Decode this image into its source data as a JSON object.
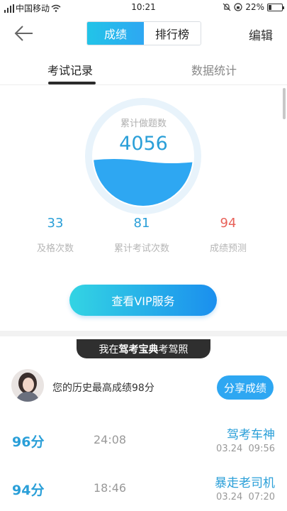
{
  "status_bar": {
    "carrier": "中国移动",
    "time": "10:21",
    "battery": "22%",
    "battery_level": 0.22
  },
  "header": {
    "tabs": [
      "成绩",
      "排行榜"
    ],
    "active_tab": 0,
    "edit_label": "编辑"
  },
  "sub_tabs": [
    "考试记录",
    "数据统计"
  ],
  "gauge": {
    "label": "累计做题数",
    "value": "4056",
    "fill_fraction": 0.45,
    "colors": {
      "ring": "#e8f3fb",
      "wave": "#2ea7f2"
    }
  },
  "stats": [
    {
      "value": "33",
      "label": "及格次数",
      "color": "#2a9fd8"
    },
    {
      "value": "81",
      "label": "累计考试次数",
      "color": "#2a9fd8"
    },
    {
      "value": "94",
      "label": "成绩预测",
      "color": "#e8625a"
    }
  ],
  "vip_button": "查看VIP服务",
  "banner": {
    "prefix": "我在",
    "brand": "驾考宝典",
    "suffix": "考驾照"
  },
  "best": {
    "text": "您的历史最高成绩98分",
    "share_label": "分享成绩"
  },
  "records": [
    {
      "score": "96分",
      "duration": "24:08",
      "title": "驾考车神",
      "date": "03.24",
      "time": "09:56"
    },
    {
      "score": "94分",
      "duration": "18:46",
      "title": "暴走老司机",
      "date": "03.24",
      "time": "07:20"
    }
  ]
}
